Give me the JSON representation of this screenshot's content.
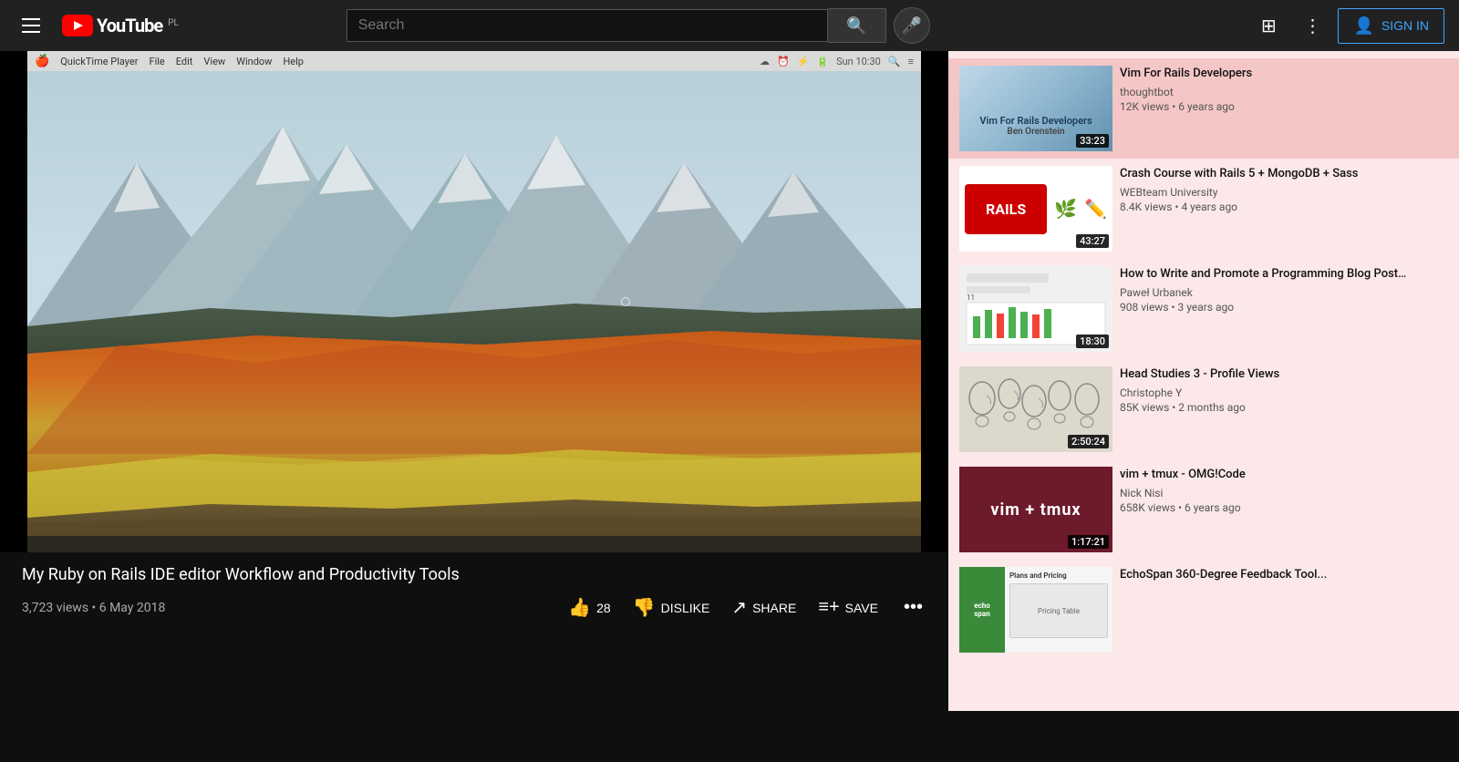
{
  "header": {
    "menu_icon": "☰",
    "logo_text": "YouTube",
    "logo_badge": "PL",
    "search_placeholder": "Search",
    "search_icon": "🔍",
    "mic_icon": "🎤",
    "grid_icon": "⊞",
    "more_icon": "⋮",
    "sign_in_label": "SIGN IN"
  },
  "video": {
    "title": "My Ruby on Rails IDE editor Workflow and Productivity Tools",
    "stats": "3,723 views • 6 May 2018",
    "like_count": "28",
    "like_icon": "👍",
    "dislike_label": "DISLIKE",
    "dislike_icon": "👎",
    "share_label": "SHARE",
    "share_icon": "➦",
    "save_label": "SAVE",
    "save_icon": "≡+",
    "more_icon": "•••",
    "mac_menu": {
      "apple": "",
      "items": [
        "QuickTime Player",
        "File",
        "Edit",
        "View",
        "Window",
        "Help"
      ]
    }
  },
  "sidebar": {
    "items": [
      {
        "id": "vim-rails",
        "title": "Vim For Rails Developers",
        "channel": "thoughtbot",
        "stats": "12K views • 6 years ago",
        "duration": "33:23",
        "thumb_type": "vim-rails",
        "active": true
      },
      {
        "id": "rails5-mongodb",
        "title": "Crash Course with Rails 5 + MongoDB + Sass",
        "channel": "WEBteam University",
        "stats": "8.4K views • 4 years ago",
        "duration": "43:27",
        "thumb_type": "rails5"
      },
      {
        "id": "programming-blog",
        "title": "How to Write and Promote a Programming Blog Post…",
        "channel": "Paweł Urbanek",
        "stats": "908 views • 3 years ago",
        "duration": "18:30",
        "thumb_type": "blog"
      },
      {
        "id": "head-studies",
        "title": "Head Studies 3 - Profile Views",
        "channel": "Christophe Y",
        "stats": "85K views • 2 months ago",
        "duration": "2:50:24",
        "thumb_type": "head-studies"
      },
      {
        "id": "vim-tmux",
        "title": "vim + tmux - OMG!Code",
        "channel": "Nick Nisi",
        "stats": "658K views • 6 years ago",
        "duration": "1:17:21",
        "thumb_type": "vim-tmux"
      },
      {
        "id": "echospan",
        "title": "EchoSpan 360-Degree Feedback Tool...",
        "channel": "",
        "stats": "",
        "duration": "",
        "thumb_type": "echospan"
      }
    ]
  }
}
